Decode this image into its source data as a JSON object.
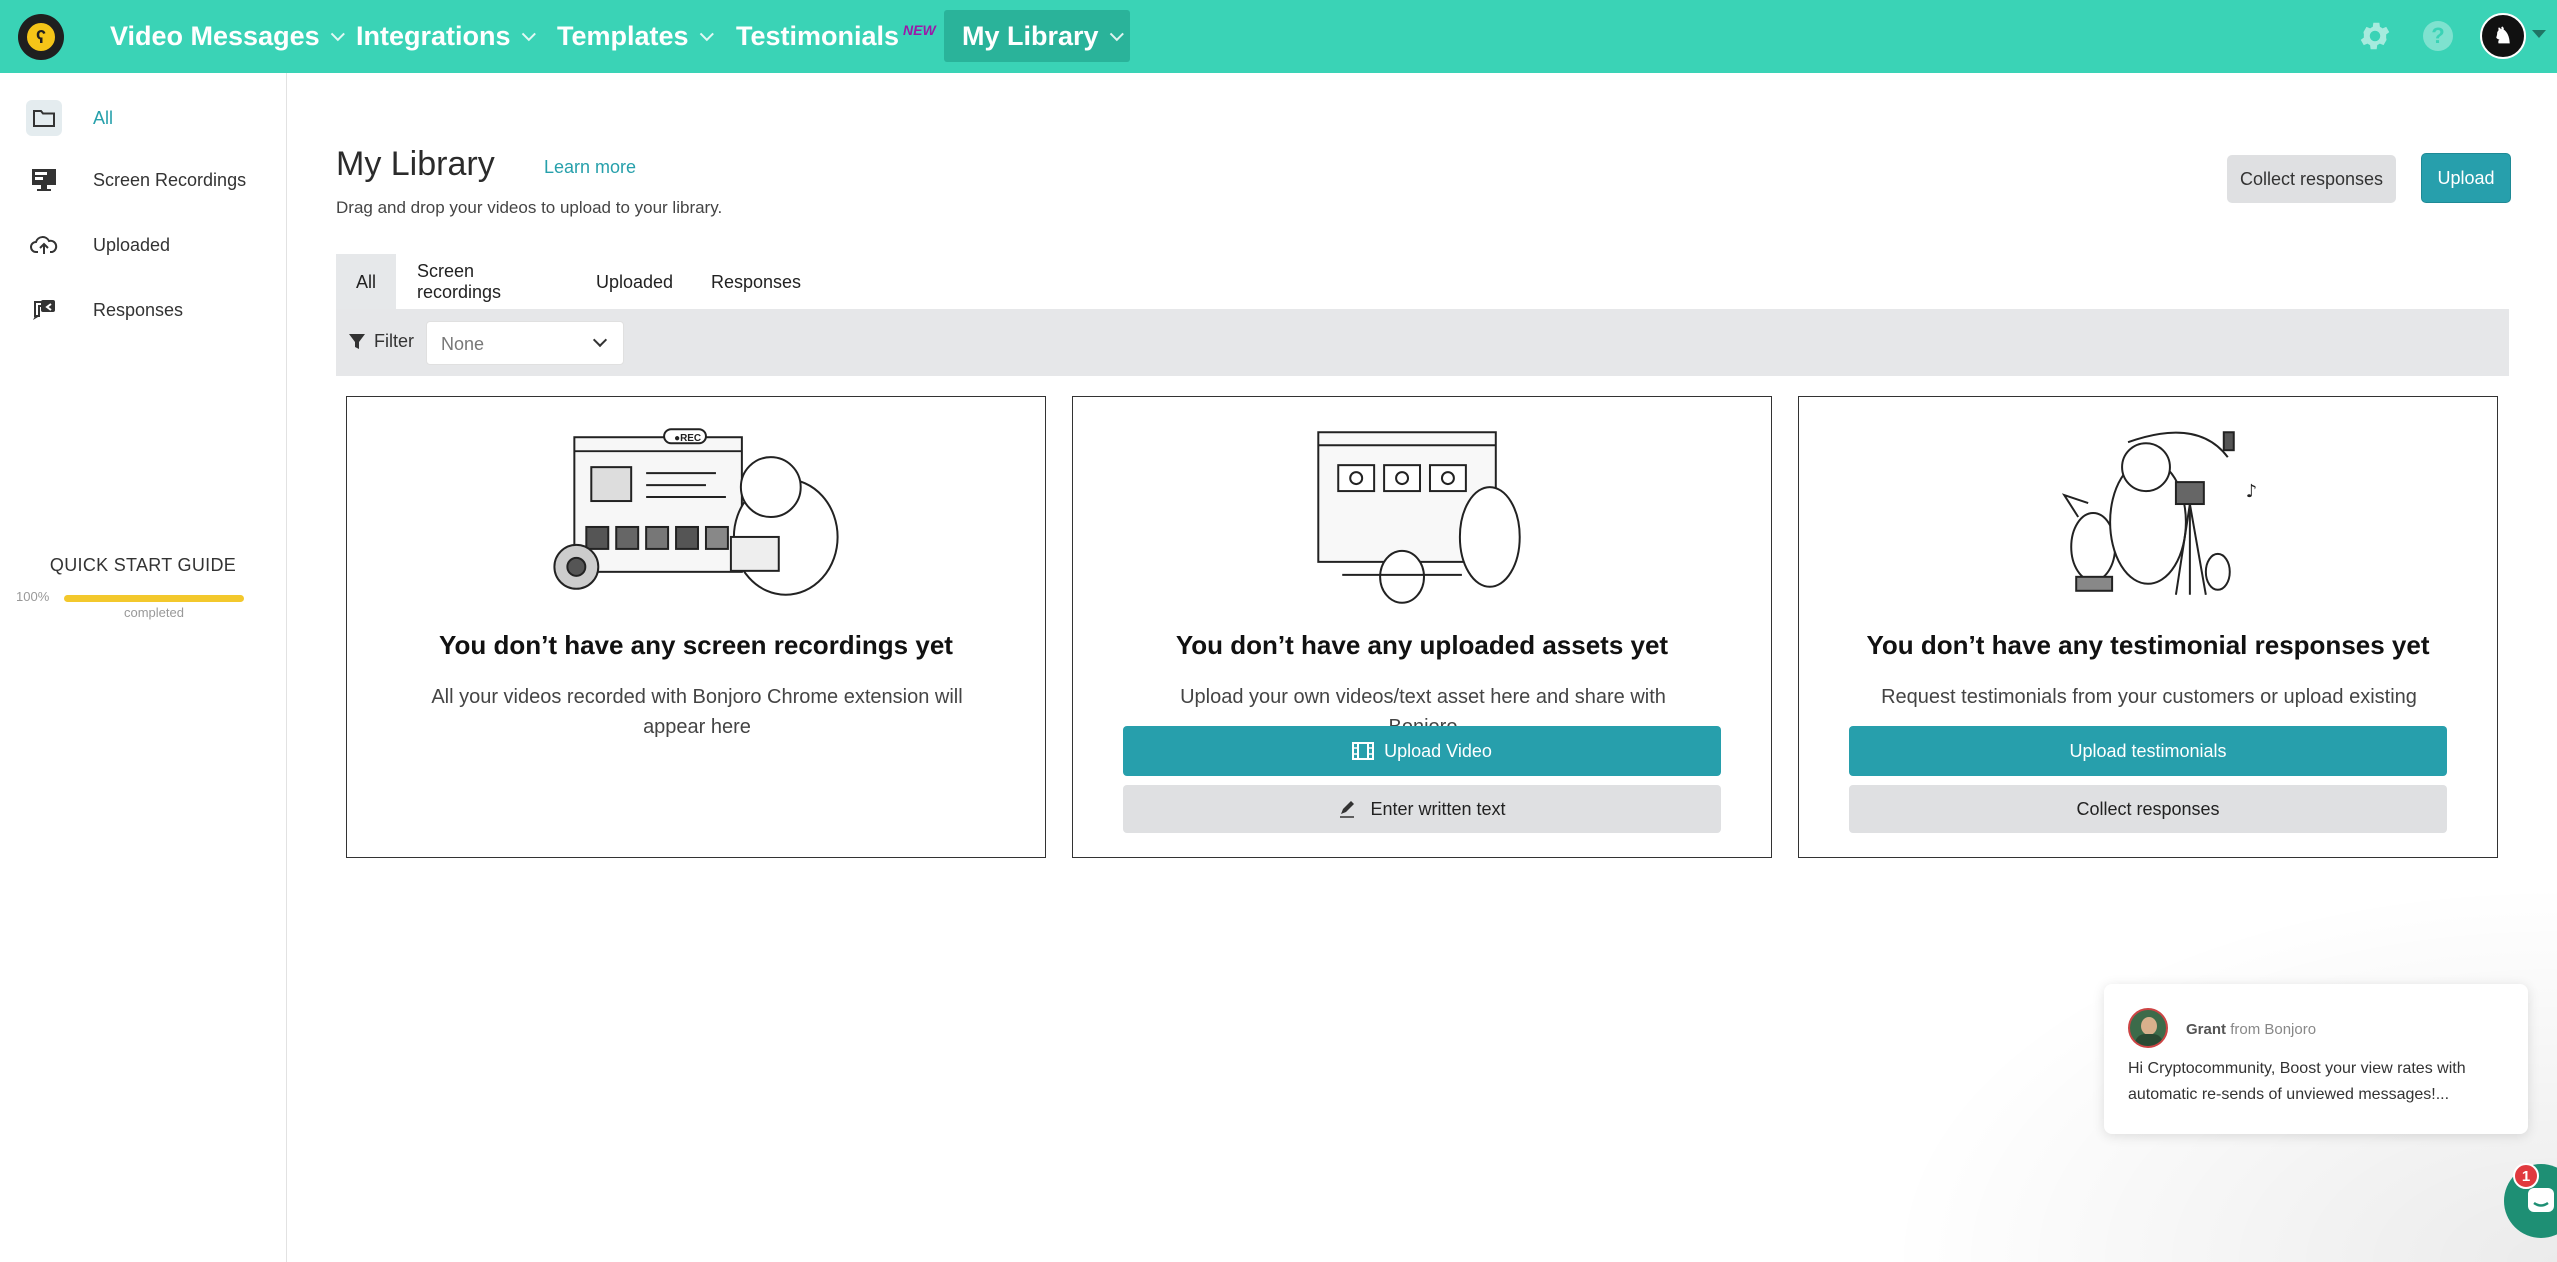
{
  "nav": {
    "video_messages": "Video Messages",
    "integrations": "Integrations",
    "templates": "Templates",
    "testimonials": "Testimonials",
    "testimonials_badge": "NEW",
    "my_library": "My Library",
    "help": "?",
    "accent_color": "#3ad3b6"
  },
  "sidebar": {
    "items": [
      {
        "label": "All",
        "icon": "folder-icon"
      },
      {
        "label": "Screen Recordings",
        "icon": "monitor-icon"
      },
      {
        "label": "Uploaded",
        "icon": "cloud-upload-icon"
      },
      {
        "label": "Responses",
        "icon": "chat-reply-icon"
      }
    ],
    "quick_start": {
      "title": "QUICK START GUIDE",
      "percent": "100%",
      "progress": 1.0,
      "completed_label": "completed"
    }
  },
  "header": {
    "title": "My Library",
    "learn_more": "Learn more",
    "subtitle": "Drag and drop your videos to upload to your library.",
    "collect_responses": "Collect responses",
    "upload": "Upload"
  },
  "tabs": [
    "All",
    "Screen recordings",
    "Uploaded",
    "Responses"
  ],
  "filter": {
    "label": "Filter",
    "selected": "None"
  },
  "cards": [
    {
      "title": "You don’t have any screen recordings yet",
      "description": "All your videos recorded with Bonjoro Chrome extension will appear here"
    },
    {
      "title": "You don’t have any uploaded assets yet",
      "description": "Upload your own videos/text asset here and share with Bonjoro",
      "primary_button": "Upload Video",
      "secondary_button": "Enter written text"
    },
    {
      "title": "You don’t have any testimonial responses yet",
      "description": "Request testimonials from your customers or upload existing",
      "primary_button": "Upload testimonials",
      "secondary_button": "Collect responses"
    }
  ],
  "chat": {
    "sender": "Grant",
    "from_label": "from Bonjoro",
    "message": "Hi Cryptocommunity, Boost your view rates with automatic re-sends of unviewed messages!...",
    "badge_count": "1"
  }
}
